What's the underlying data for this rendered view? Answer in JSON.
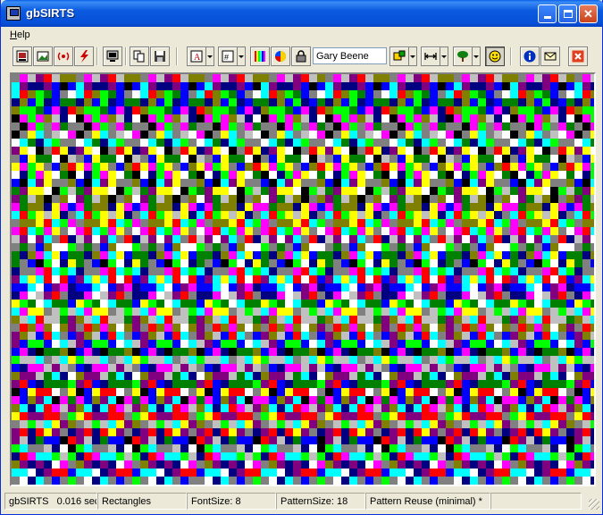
{
  "window": {
    "title": "gbSIRTS"
  },
  "menu": [
    {
      "label": "Help"
    }
  ],
  "toolbar": {
    "name_value": "Gary Beene",
    "buttons": [
      "image-icon",
      "picture-icon",
      "broadcast-icon",
      "lightning-icon",
      "monitor-icon",
      "copy-icon",
      "save-icon",
      "font-icon",
      "pattern-icon",
      "color-bars-icon",
      "color-wheel-icon",
      "lock-icon",
      "puzzle-icon",
      "width-icon",
      "tree-icon",
      "smiley-icon",
      "info-icon",
      "mail-icon",
      "exit-icon"
    ]
  },
  "stereogram": {
    "palette": [
      "#0000ff",
      "#00ffff",
      "#000080",
      "#ffff00",
      "#ff00ff",
      "#000000",
      "#ffffff",
      "#c0c0c0",
      "#808080",
      "#ff0000",
      "#008000",
      "#00ff00",
      "#808000",
      "#800080"
    ]
  },
  "status": {
    "app": "gbSIRTS",
    "time": "0.016 sec",
    "mode": "Rectangles",
    "font_size": "FontSize: 8",
    "pattern_size": "PatternSize: 18",
    "pattern_reuse": "Pattern Reuse (minimal) *"
  }
}
